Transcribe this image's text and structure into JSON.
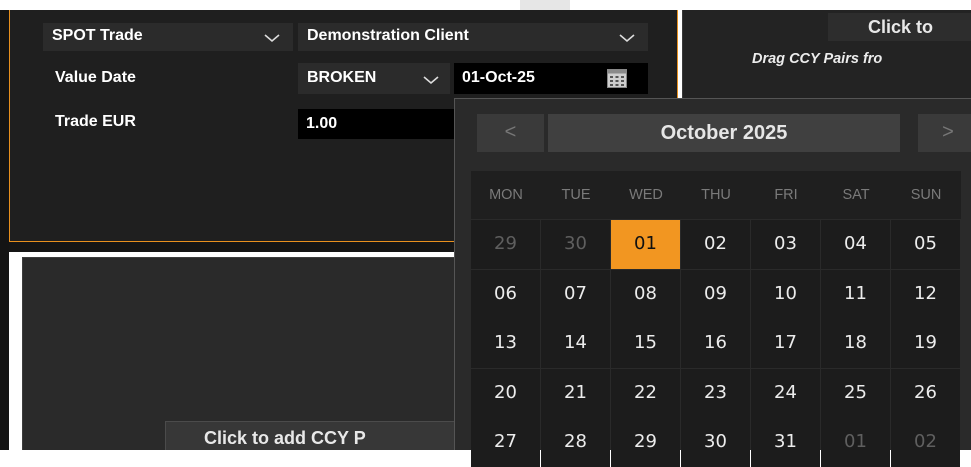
{
  "trade_form": {
    "trade_type": "SPOT Trade",
    "client": "Demonstration Client",
    "value_date_label": "Value Date",
    "tenor": "BROKEN",
    "date_value": "01-Oct-25",
    "trade_label": "Trade EUR",
    "amount": "1.00"
  },
  "right_panel": {
    "button_label": "Click to",
    "hint": "Drag CCY Pairs fro"
  },
  "lower_panel": {
    "add_button_label": "Click to add CCY P"
  },
  "calendar": {
    "month_label": "October 2025",
    "prev_icon": "chevron-left-icon",
    "next_icon": "chevron-right-icon",
    "prev_glyph": "<",
    "next_glyph": ">",
    "weekdays": [
      "MON",
      "TUE",
      "WED",
      "THU",
      "FRI",
      "SAT",
      "SUN"
    ],
    "weeks": [
      [
        "29",
        "30",
        "01",
        "02",
        "03",
        "04",
        "05"
      ],
      [
        "06",
        "07",
        "08",
        "09",
        "10",
        "11",
        "12"
      ],
      [
        "13",
        "14",
        "15",
        "16",
        "17",
        "18",
        "19"
      ],
      [
        "20",
        "21",
        "22",
        "23",
        "24",
        "25",
        "26"
      ],
      [
        "27",
        "28",
        "29",
        "30",
        "31",
        "01",
        "02"
      ]
    ],
    "selected_day": "01",
    "accent_color": "#f29621"
  },
  "colors": {
    "border_accent": "#e8901e",
    "panel_bg": "#1f1f1f"
  }
}
